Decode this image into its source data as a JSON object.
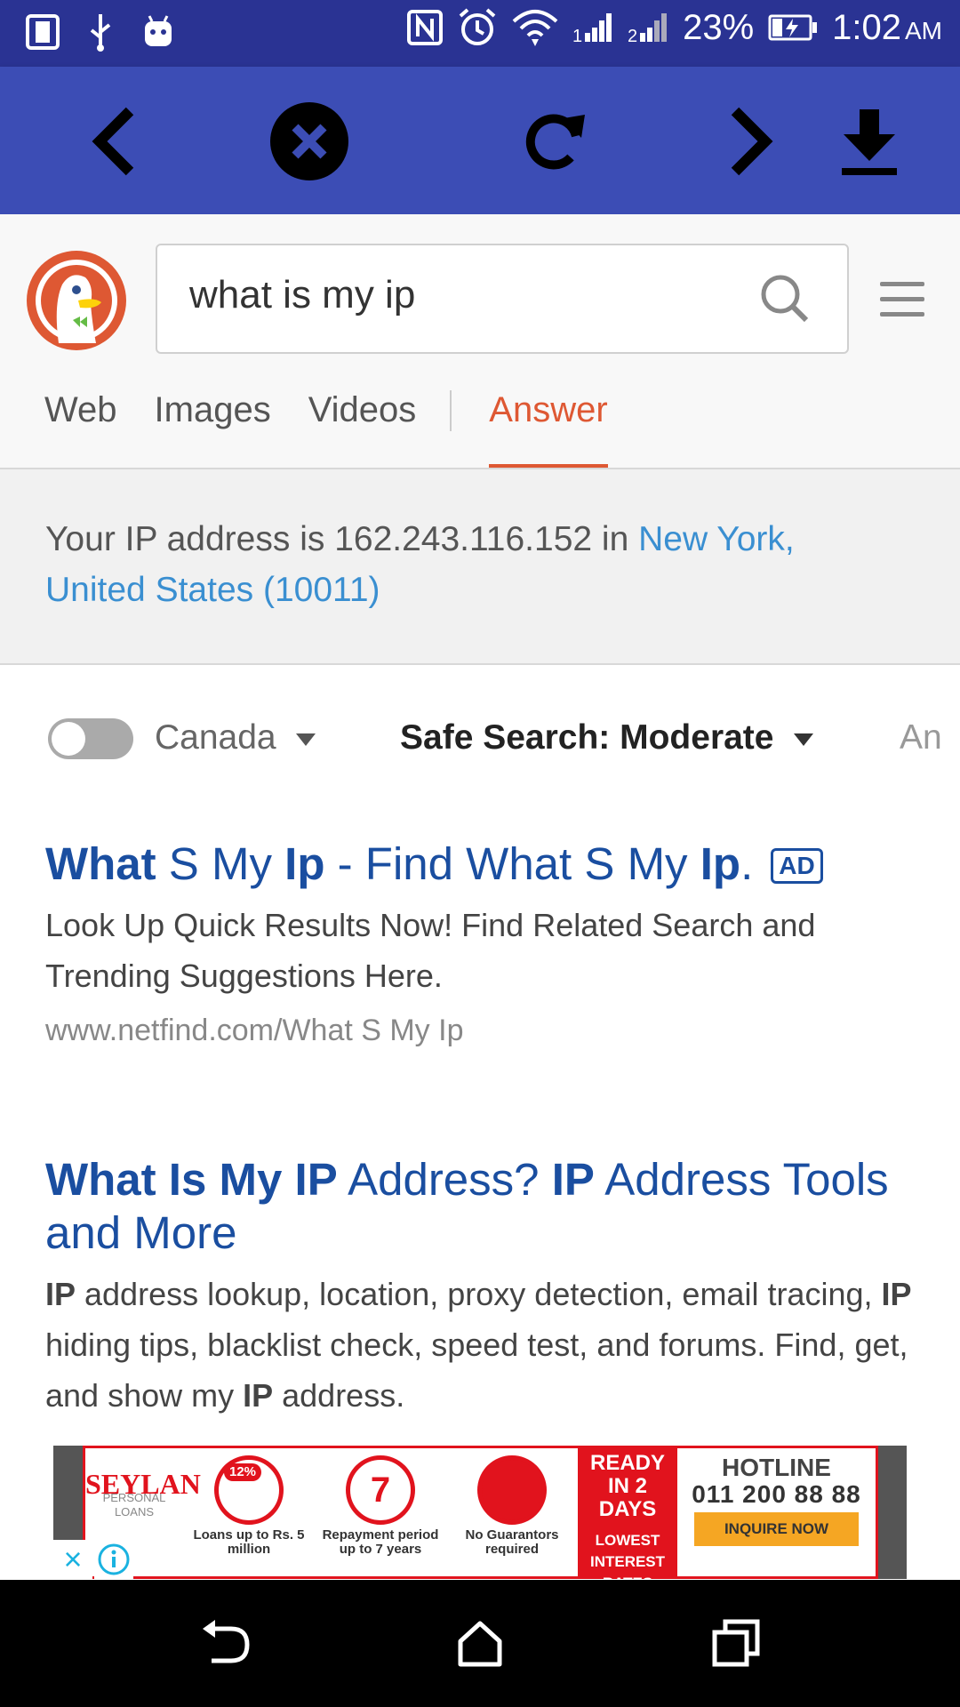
{
  "status_bar": {
    "battery": "23%",
    "time": "1:02",
    "ampm": "AM"
  },
  "toolbar": {
    "back_icon": "chevron-left-icon",
    "stop_icon": "close-circle-icon",
    "reload_icon": "refresh-icon",
    "forward_icon": "chevron-right-icon",
    "download_icon": "download-icon"
  },
  "search": {
    "query": "what is my ip"
  },
  "tabs": [
    {
      "label": "Web"
    },
    {
      "label": "Images"
    },
    {
      "label": "Videos"
    },
    {
      "label": "Answer"
    }
  ],
  "ip_answer": {
    "prefix": "Your IP address is 162.243.116.152 in ",
    "location": "New York, United States (10011)"
  },
  "filters": {
    "region": "Canada",
    "safe_search": "Safe Search: Moderate",
    "time_partial": "An"
  },
  "results": [
    {
      "title_parts": [
        "What",
        " S My ",
        "Ip",
        " - Find What S My ",
        "Ip",
        "."
      ],
      "badge": "AD",
      "snippet": "Look Up Quick Results Now! Find Related Search and Trending Suggestions Here.",
      "url": "www.netfind.com/What S My Ip"
    },
    {
      "title_parts": [
        "What Is My IP",
        " Address? ",
        "IP",
        " Address Tools and More"
      ],
      "snippet_parts": [
        "IP",
        " address lookup, location, proxy detection, email tracing, ",
        "IP",
        " hiding tips, blacklist check, speed test, and forums. Find, get, and show my ",
        "IP",
        " address."
      ]
    }
  ],
  "ad": {
    "brand": "SEYLAN",
    "brand_sub": "PERSONAL LOANS",
    "feature1": "Loans up to Rs. 5 million",
    "feature1_badge": "12%",
    "feature2": "Repayment period up to 7 years",
    "feature2_badge": "7",
    "feature3": "No Guarantors required",
    "red_big": "READY IN 2 DAYS",
    "red_small": "LOWEST INTEREST RATES",
    "hotline_label": "HOTLINE",
    "hotline_number": "011 200 88 88",
    "cta": "INQUIRE NOW",
    "close": "×"
  },
  "colors": {
    "status_bar": "#2a3393",
    "toolbar": "#3c4db5",
    "accent": "#de5833",
    "link": "#1a4ea0",
    "location_link": "#3a8fd1"
  }
}
